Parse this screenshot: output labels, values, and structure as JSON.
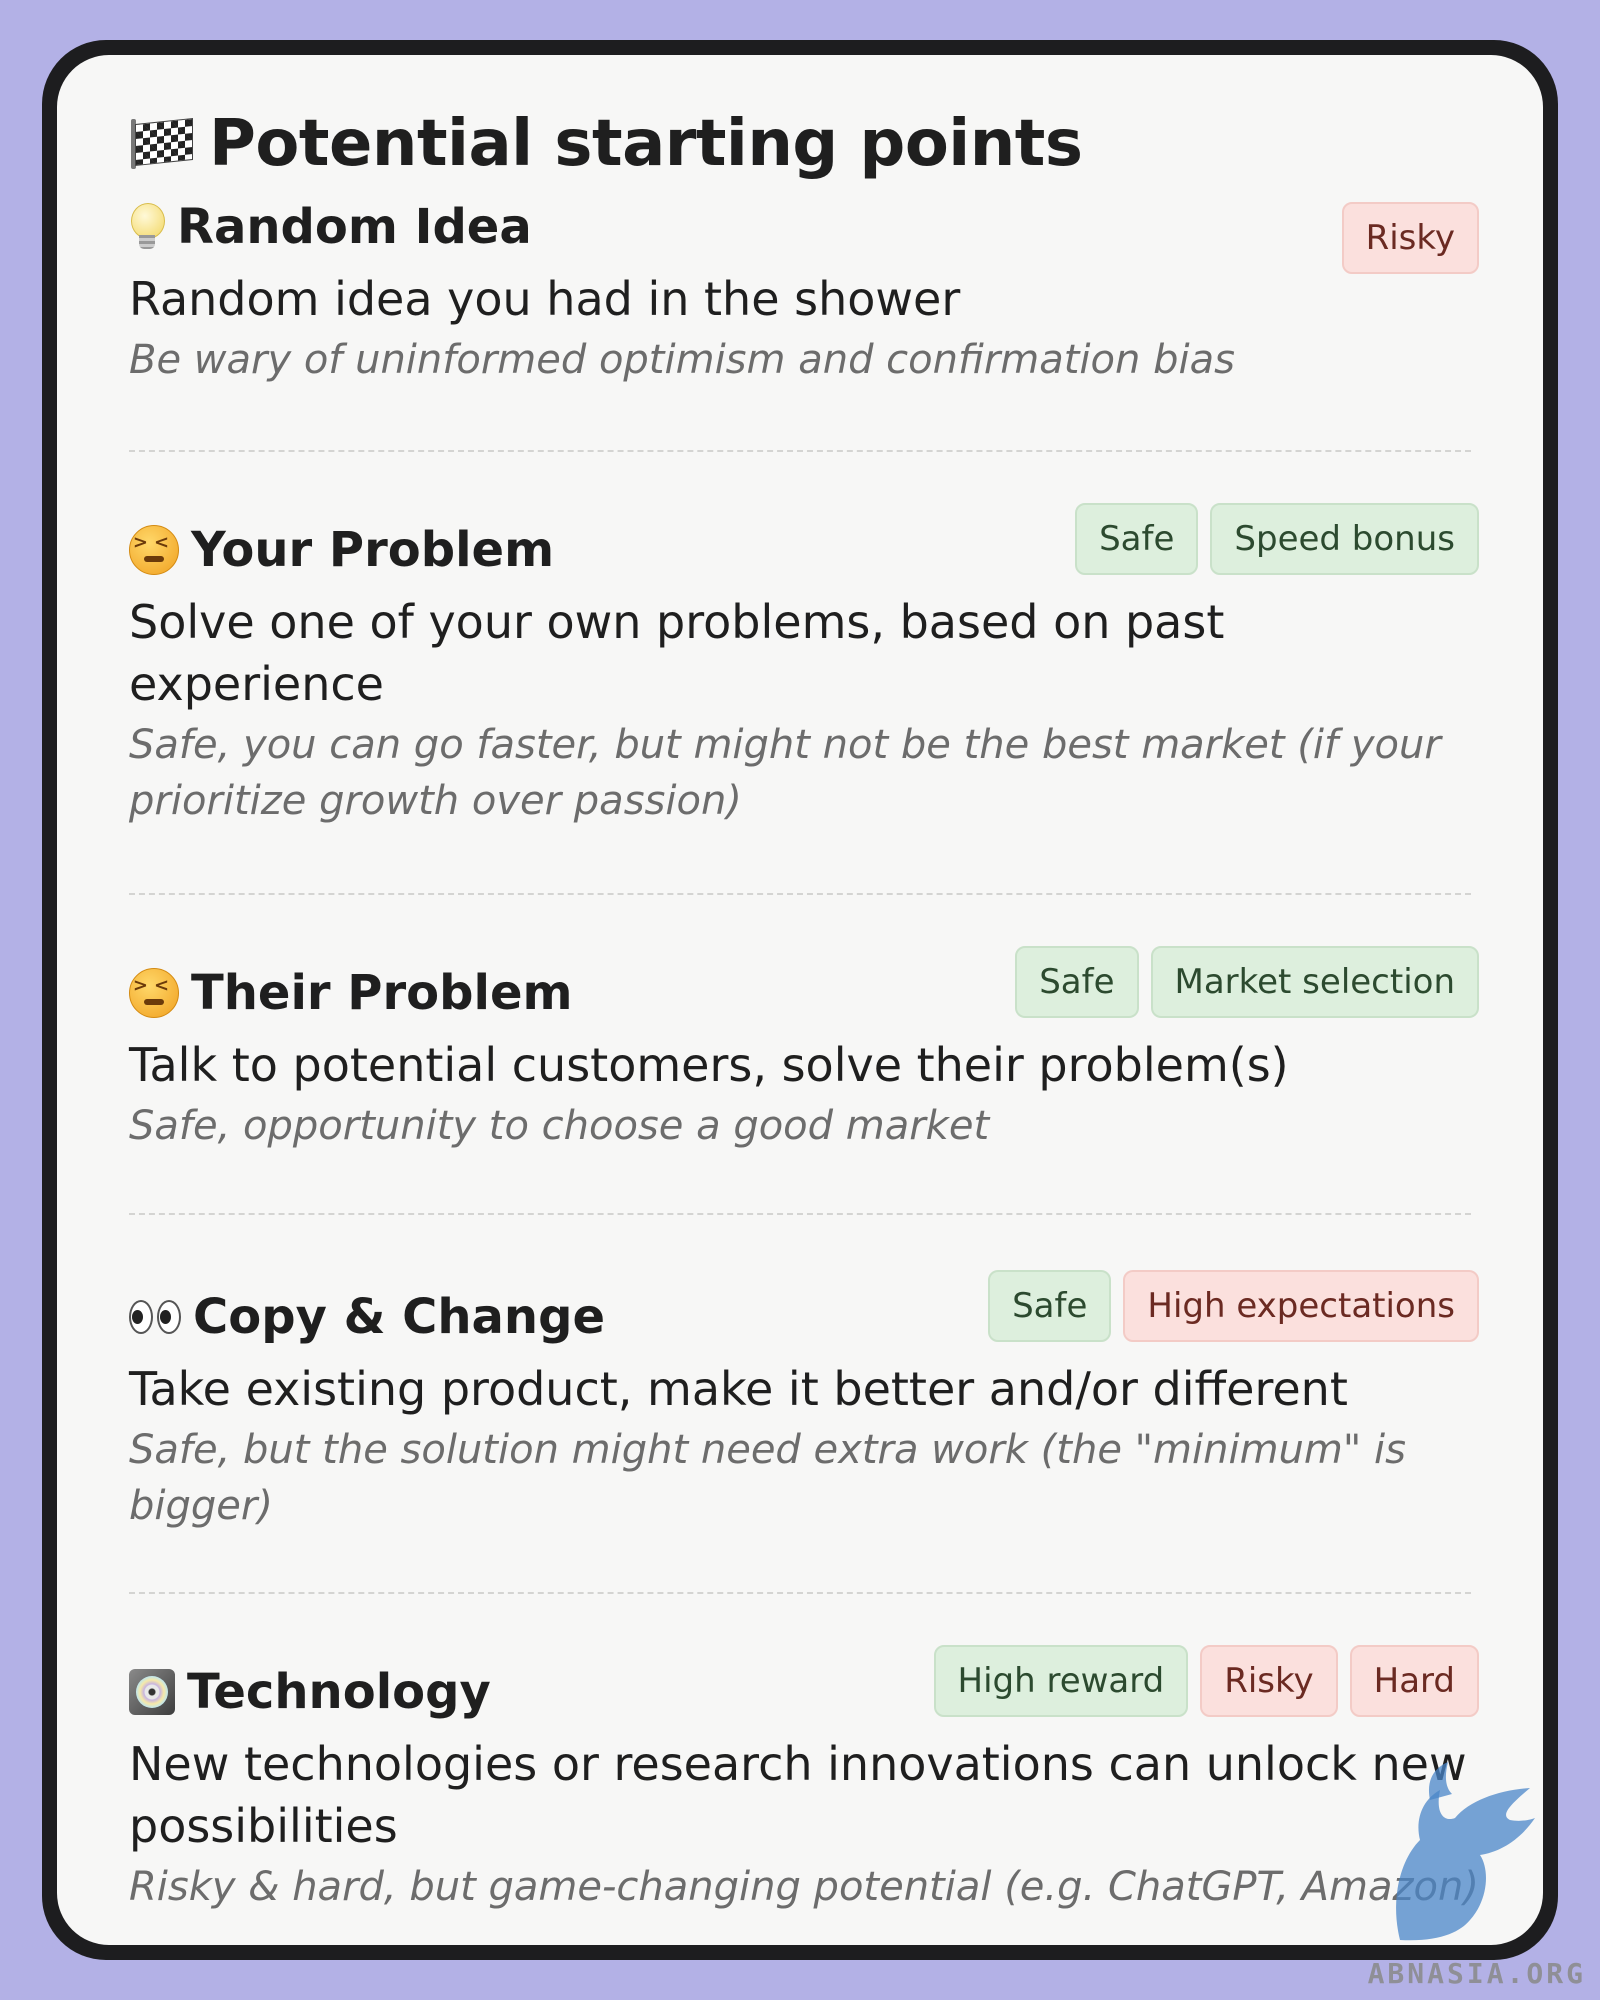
{
  "title": "Potential starting points",
  "sections": [
    {
      "icon": "lightbulb-icon",
      "title": "Random Idea",
      "tags": [
        {
          "label": "Risky",
          "tone": "red"
        }
      ],
      "description": "Random idea you had in the shower",
      "note": "Be wary of uninformed optimism and confirmation bias"
    },
    {
      "icon": "persevering-face-icon",
      "title": "Your Problem",
      "tags": [
        {
          "label": "Safe",
          "tone": "green"
        },
        {
          "label": "Speed bonus",
          "tone": "green"
        }
      ],
      "description": "Solve one of  your own problems, based on past experience",
      "note": "Safe, you can go faster, but might not be the best market (if your prioritize growth over passion)"
    },
    {
      "icon": "persevering-face-icon",
      "title": "Their Problem",
      "tags": [
        {
          "label": "Safe",
          "tone": "green"
        },
        {
          "label": "Market selection",
          "tone": "green"
        }
      ],
      "description": "Talk to potential customers, solve their problem(s)",
      "note": "Safe, opportunity to choose a good market"
    },
    {
      "icon": "eyes-icon",
      "title": "Copy & Change",
      "tags": [
        {
          "label": "Safe",
          "tone": "green"
        },
        {
          "label": "High expectations",
          "tone": "red"
        }
      ],
      "description": "Take existing product, make it better and/or different",
      "note": "Safe, but the solution might need extra work (the \"minimum\" is bigger)"
    },
    {
      "icon": "computer-disk-icon",
      "title": "Technology",
      "tags": [
        {
          "label": "High reward",
          "tone": "green"
        },
        {
          "label": "Risky",
          "tone": "red"
        },
        {
          "label": "Hard",
          "tone": "red"
        }
      ],
      "description": "New technologies or research innovations can unlock new possibilities",
      "note": "Risky & hard, but game-changing potential (e.g. ChatGPT, Amazon)"
    }
  ],
  "colors": {
    "background": "#b3b1e6",
    "card": "#f7f7f6",
    "tag_green_bg": "#ddefdd",
    "tag_red_bg": "#fbe0dd"
  },
  "watermark": "ABNASIA.ORG"
}
